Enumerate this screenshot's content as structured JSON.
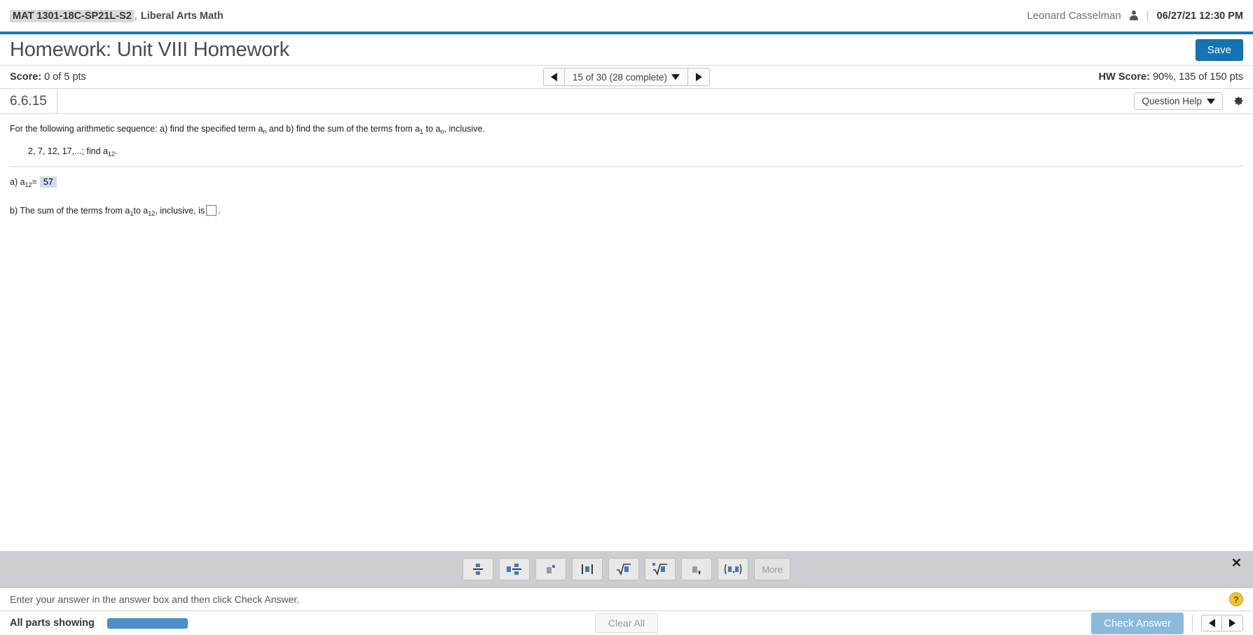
{
  "topbar": {
    "course_code": "MAT 1301-18C-SP21L-S2",
    "course_separator": ",",
    "course_name": "Liberal Arts Math",
    "user_name": "Leonard Casselman",
    "person_icon": "person-icon",
    "pipe": "|",
    "timestamp": "06/27/21 12:30 PM"
  },
  "title_row": {
    "title": "Homework: Unit VIII Homework",
    "save_label": "Save"
  },
  "score_row": {
    "score_label": "Score:",
    "score_value": "0 of 5 pts",
    "nav_prev_icon": "triangle-left-icon",
    "nav_text": "15 of 30 (28 complete)",
    "nav_caret_icon": "caret-down-icon",
    "nav_next_icon": "triangle-right-icon",
    "hw_label": "HW Score:",
    "hw_value": "90%, 135 of 150 pts"
  },
  "exercise_row": {
    "number": "6.6.15",
    "question_help_label": "Question Help",
    "question_help_caret": "caret-down-icon",
    "gear_icon": "gear-icon"
  },
  "question": {
    "prompt_part1": "For the following arithmetic sequence: a) find the specified term a",
    "prompt_sub1": "n",
    "prompt_part2": " and b) find the sum of the terms from a",
    "prompt_sub2": "1",
    "prompt_part3": " to a",
    "prompt_sub3": "n",
    "prompt_part4": ", inclusive.",
    "sequence_text": "2, 7, 12, 17,...; find a",
    "sequence_sub": "12",
    "sequence_period": ".",
    "part_a_label": "a) a",
    "part_a_sub": "12",
    "part_a_eq": " = ",
    "part_a_answer": "57",
    "part_b_text1": "b) The sum of the terms from a",
    "part_b_sub1": "1",
    "part_b_text2": " to a",
    "part_b_sub2": "12",
    "part_b_text3": ", inclusive, is",
    "part_b_answer": "",
    "part_b_period": "."
  },
  "palette": {
    "close_icon": "close-icon",
    "buttons": [
      {
        "name": "fraction-button",
        "glyph": "fraction-icon"
      },
      {
        "name": "mixed-number-button",
        "glyph": "mixed-number-icon"
      },
      {
        "name": "exponent-button",
        "glyph": "exponent-icon"
      },
      {
        "name": "absolute-value-button",
        "glyph": "absolute-value-icon"
      },
      {
        "name": "square-root-button",
        "glyph": "square-root-icon"
      },
      {
        "name": "nth-root-button",
        "glyph": "nth-root-icon"
      },
      {
        "name": "list-comma-button",
        "glyph": "list-comma-icon"
      },
      {
        "name": "ordered-pair-button",
        "glyph": "ordered-pair-icon"
      }
    ],
    "more_label": "More"
  },
  "instruction": {
    "text": "Enter your answer in the answer box and then click Check Answer.",
    "help_glyph": "?",
    "help_icon": "help-icon"
  },
  "footer": {
    "all_parts_label": "All parts showing",
    "progress_percent": 100,
    "clear_all_label": "Clear All",
    "check_answer_label": "Check Answer",
    "prev_icon": "triangle-left-icon",
    "next_icon": "triangle-right-icon"
  },
  "colors": {
    "accent_teal": "#177ba3",
    "save_blue": "#1573b3",
    "progress_blue": "#4a8fc8",
    "check_disabled_blue": "#8bbadd",
    "palette_gray": "#cbcdd1",
    "answer_highlight": "#cfdced",
    "help_yellow": "#f0c33c"
  }
}
